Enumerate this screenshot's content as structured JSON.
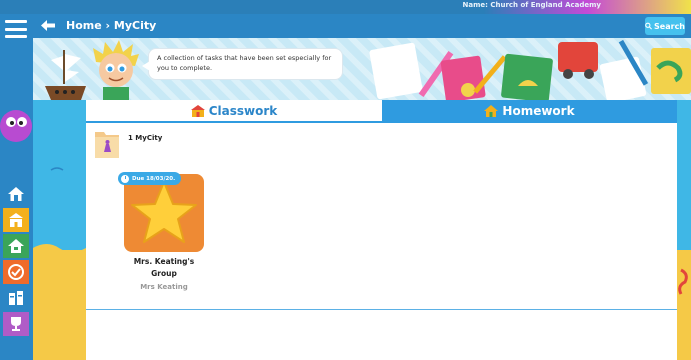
{
  "top_strip": {
    "org_text": "Name: Church of England Academy"
  },
  "nav": {
    "menu_icon": "hamburger-icon",
    "items": [
      {
        "icon": "home-icon",
        "color": "#2b86c5"
      },
      {
        "icon": "school-icon",
        "color": "#f3b01b"
      },
      {
        "icon": "house-share-icon",
        "color": "#3aa559"
      },
      {
        "icon": "checkmark-icon",
        "color": "#ef6b2b"
      },
      {
        "icon": "books-icon",
        "color": "#2b86c5"
      },
      {
        "icon": "trophy-icon",
        "color": "#b05cc7"
      }
    ]
  },
  "header": {
    "breadcrumb": "Home › MyCity",
    "search_label": "Search",
    "back_icon": "back-arrow-icon"
  },
  "banner": {
    "message": "A collection of tasks that have been set especially for you to complete."
  },
  "tabs": {
    "classwork": "Classwork",
    "homework": "Homework"
  },
  "folder": {
    "label": "1 MyCity",
    "icon": "folder-icon"
  },
  "task": {
    "due": "Due 18/03/20.",
    "title_line1": "Mrs. Keating's",
    "title_line2": "Group",
    "teacher": "Mrs Keating",
    "icon": "star-icon"
  },
  "colors": {
    "accent_blue": "#2f9be0",
    "header_blue": "#2b86c5",
    "task_orange": "#ee8a34",
    "star_yellow": "#ffcf3a"
  }
}
